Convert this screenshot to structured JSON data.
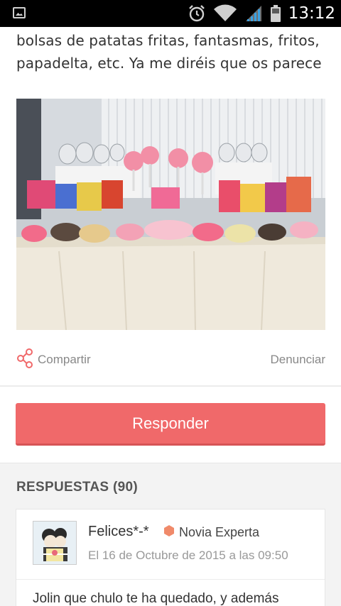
{
  "status_bar": {
    "time": "13:12",
    "icons": [
      "gallery-icon",
      "alarm-icon",
      "wifi-icon",
      "signal-icon",
      "battery-icon"
    ]
  },
  "post": {
    "text_lines": [
      "bolsas de patatas fritas, fantasmas, fritos,",
      "papadelta, etc. Ya me diréis que os parece"
    ]
  },
  "actions": {
    "share_label": "Compartir",
    "report_label": "Denunciar"
  },
  "reply_button": {
    "label": "Responder"
  },
  "replies": {
    "header": "RESPUESTAS (90)",
    "items": [
      {
        "author": "Felices*-*",
        "badge": "Novia Experta",
        "date": "El 16 de Octubre de 2015 a las 09:50",
        "text": "Jolin que chulo te ha quedado, y además"
      }
    ]
  },
  "colors": {
    "accent": "#f0696a",
    "badge": "#f08a6a",
    "status_bar": "#000000"
  }
}
